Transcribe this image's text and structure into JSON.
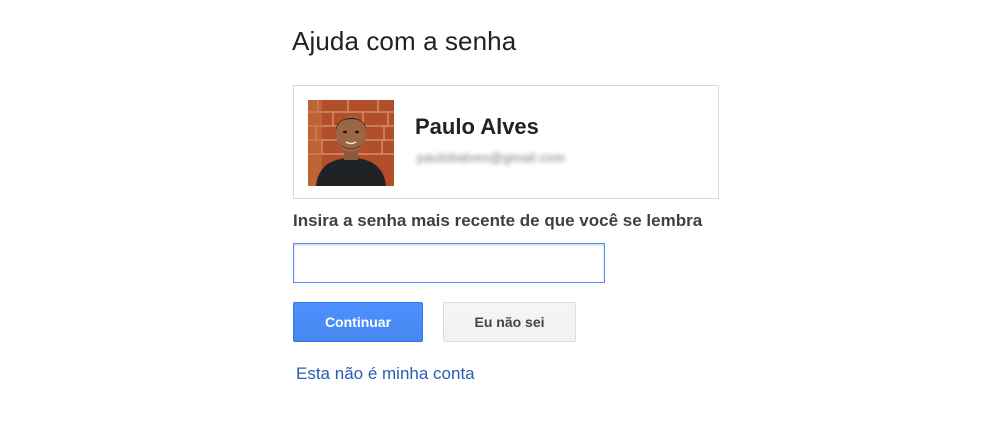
{
  "page": {
    "title": "Ajuda com a senha"
  },
  "account": {
    "name": "Paulo Alves",
    "email": "paulobalves@gmail.com",
    "avatar_icon": "user-photo"
  },
  "form": {
    "label": "Insira a senha mais recente de que você se lembra",
    "password_value": "",
    "password_placeholder": ""
  },
  "actions": {
    "continue_label": "Continuar",
    "dont_know_label": "Eu não sei",
    "not_my_account_label": "Esta não é minha conta"
  },
  "colors": {
    "primary_button": "#4d90fe",
    "link": "#2a5db0",
    "input_focus_border": "#4d90fe"
  }
}
